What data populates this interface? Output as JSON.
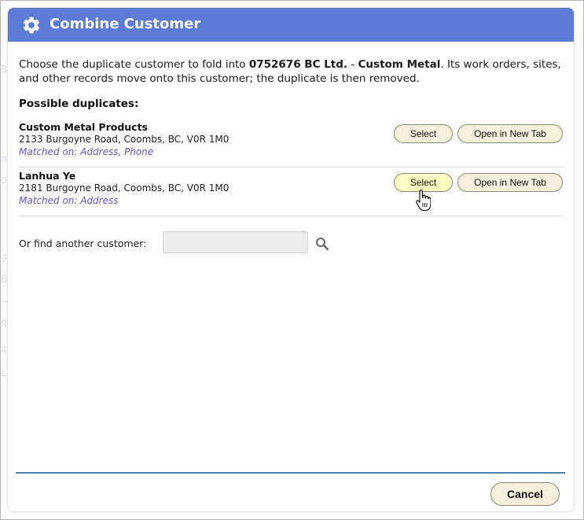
{
  "dialog": {
    "title": "Combine Customer",
    "title_icon": "gear-icon",
    "title_bar_color": "#5b7bd5"
  },
  "intro": {
    "prefix": "Choose the duplicate customer to fold into ",
    "target_id": "0752676 BC Ltd.",
    "separator": " - ",
    "target_name": "Custom Metal",
    "suffix": ". Its work orders, sites, and other records move onto this customer; the duplicate is then removed."
  },
  "duplicates": {
    "heading": "Possible duplicates:",
    "items": [
      {
        "name": "Custom Metal Products",
        "address": "2133 Burgoyne Road, Coombs, BC, V0R 1M0",
        "matched": "Matched on: Address, Phone",
        "select_label": "Select",
        "open_label": "Open in New Tab"
      },
      {
        "name": "Lanhua Ye",
        "address": "2181 Burgoyne Road, Coombs, BC, V0R 1M0",
        "matched": "Matched on: Address",
        "select_label": "Select",
        "open_label": "Open in New Tab"
      }
    ]
  },
  "find": {
    "label": "Or find another customer:",
    "value": "",
    "search_icon": "search-icon"
  },
  "footer": {
    "cancel_label": "Cancel"
  },
  "colors": {
    "button_bg": "#f3f1dc",
    "button_hover_bg": "#fbfbc4",
    "match_text": "#6a4fd6",
    "footer_rule": "#4a7fa8"
  }
}
